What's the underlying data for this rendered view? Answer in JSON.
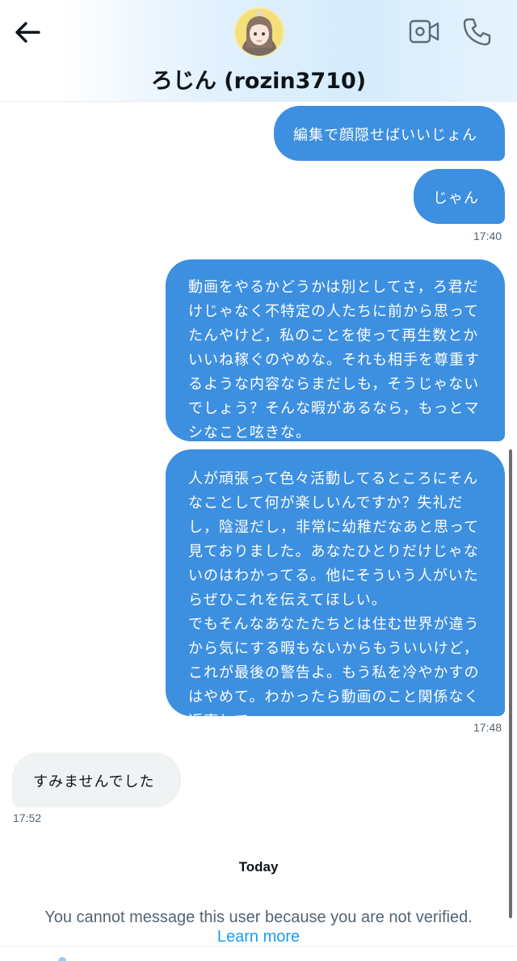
{
  "header": {
    "contact_name": "ろじん (rozin3710)",
    "icons": {
      "back": "arrow-left-icon",
      "video": "video-camera-icon",
      "call": "phone-icon"
    }
  },
  "messages": [
    {
      "direction": "out",
      "text": "編集で顔隠せばいいじょん"
    },
    {
      "direction": "out",
      "text": "じゃん"
    },
    {
      "direction": "out",
      "text": "動画をやるかどうかは別としてさ，ろ君だ\nけじゃなく不特定の人たちに前から思って\nたんやけど，私のことを使って再生数とか\nいいね稼ぐのやめな。それも相手を尊重す\nるような内容ならまだしも，そうじゃない\nでしょう？そんな暇があるなら，もっとマ\nシなこと呟きな。"
    },
    {
      "direction": "out",
      "text": "人が頑張って色々活動してるところにそん\nなことして何が楽しいんですか？失礼だ\nし，陰湿だし，非常に幼稚だなあと思って\n見ておりました。あなたひとりだけじゃな\nいのはわかってる。他にそういう人がいた\nらぜひこれを伝えてほしい。\nでもそんなあなたたちとは住む世界が違う\nから気にする暇もないからもういいけど，\nこれが最後の警告よ。もう私を冷やかすの\nはやめて。わかったら動画のこと関係なく\n返事して。"
    },
    {
      "direction": "in",
      "text": "すみませんでした"
    }
  ],
  "timestamps": {
    "t1": "17:40",
    "t2": "17:48",
    "t3": "17:52"
  },
  "footer": {
    "today_label": "Today",
    "notice": "You cannot message this user because you are not verified.",
    "learn_more": "Learn more"
  },
  "colors": {
    "outgoing_bubble": "#3d8fe0",
    "incoming_bubble": "#eff3f4",
    "link": "#1d9bf0",
    "muted_text": "#536471"
  }
}
